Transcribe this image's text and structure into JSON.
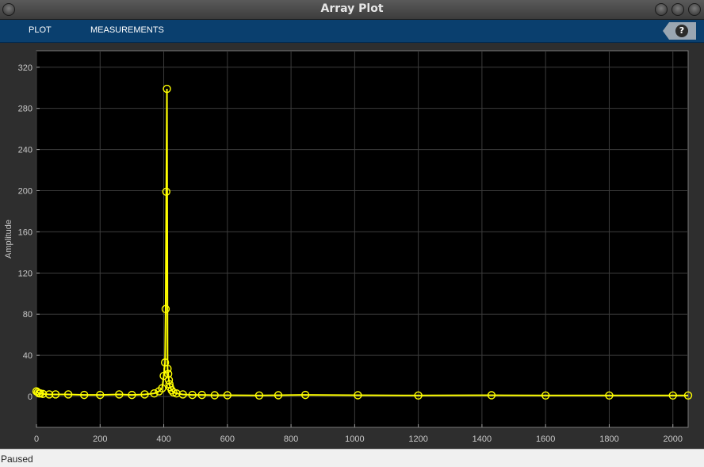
{
  "window": {
    "title": "Array Plot"
  },
  "toolstrip": {
    "tabs": [
      {
        "label": "PLOT"
      },
      {
        "label": "MEASUREMENTS"
      }
    ],
    "help_label": "?"
  },
  "status": {
    "text": "Paused"
  },
  "colors": {
    "background": "#000000",
    "series": "#ffff00",
    "grid": "#3c3c3c",
    "toolstrip": "#0a3f6e"
  },
  "chart_data": {
    "type": "line",
    "marker": "circle",
    "xlabel": "",
    "ylabel": "Amplitude",
    "xlim": [
      0,
      2048
    ],
    "ylim": [
      -30,
      336
    ],
    "xticks": [
      0,
      200,
      400,
      600,
      800,
      1000,
      1200,
      1400,
      1600,
      1800,
      2000
    ],
    "yticks": [
      0,
      40,
      80,
      120,
      160,
      200,
      240,
      280,
      320
    ],
    "grid": true,
    "series": [
      {
        "color": "#ffff00",
        "x": [
          0,
          4,
          8,
          12,
          20,
          40,
          60,
          100,
          150,
          200,
          260,
          300,
          340,
          370,
          385,
          395,
          400,
          404,
          406,
          408,
          410,
          412,
          414,
          416,
          418,
          420,
          425,
          430,
          440,
          460,
          490,
          520,
          560,
          600,
          700,
          760,
          845,
          1010,
          1200,
          1430,
          1600,
          1800,
          2000,
          2048
        ],
        "y": [
          5,
          4,
          3,
          3,
          2.5,
          2,
          2,
          2,
          1.5,
          1.5,
          2,
          1.5,
          2,
          3,
          5,
          8,
          20,
          33,
          85,
          199,
          299,
          27,
          22,
          16,
          12,
          9,
          6,
          4,
          3,
          2,
          1.5,
          1.5,
          1.2,
          1.2,
          1.0,
          1.2,
          1.5,
          1.2,
          1.0,
          1.2,
          1.0,
          1.0,
          1.0,
          1.0
        ]
      }
    ]
  }
}
